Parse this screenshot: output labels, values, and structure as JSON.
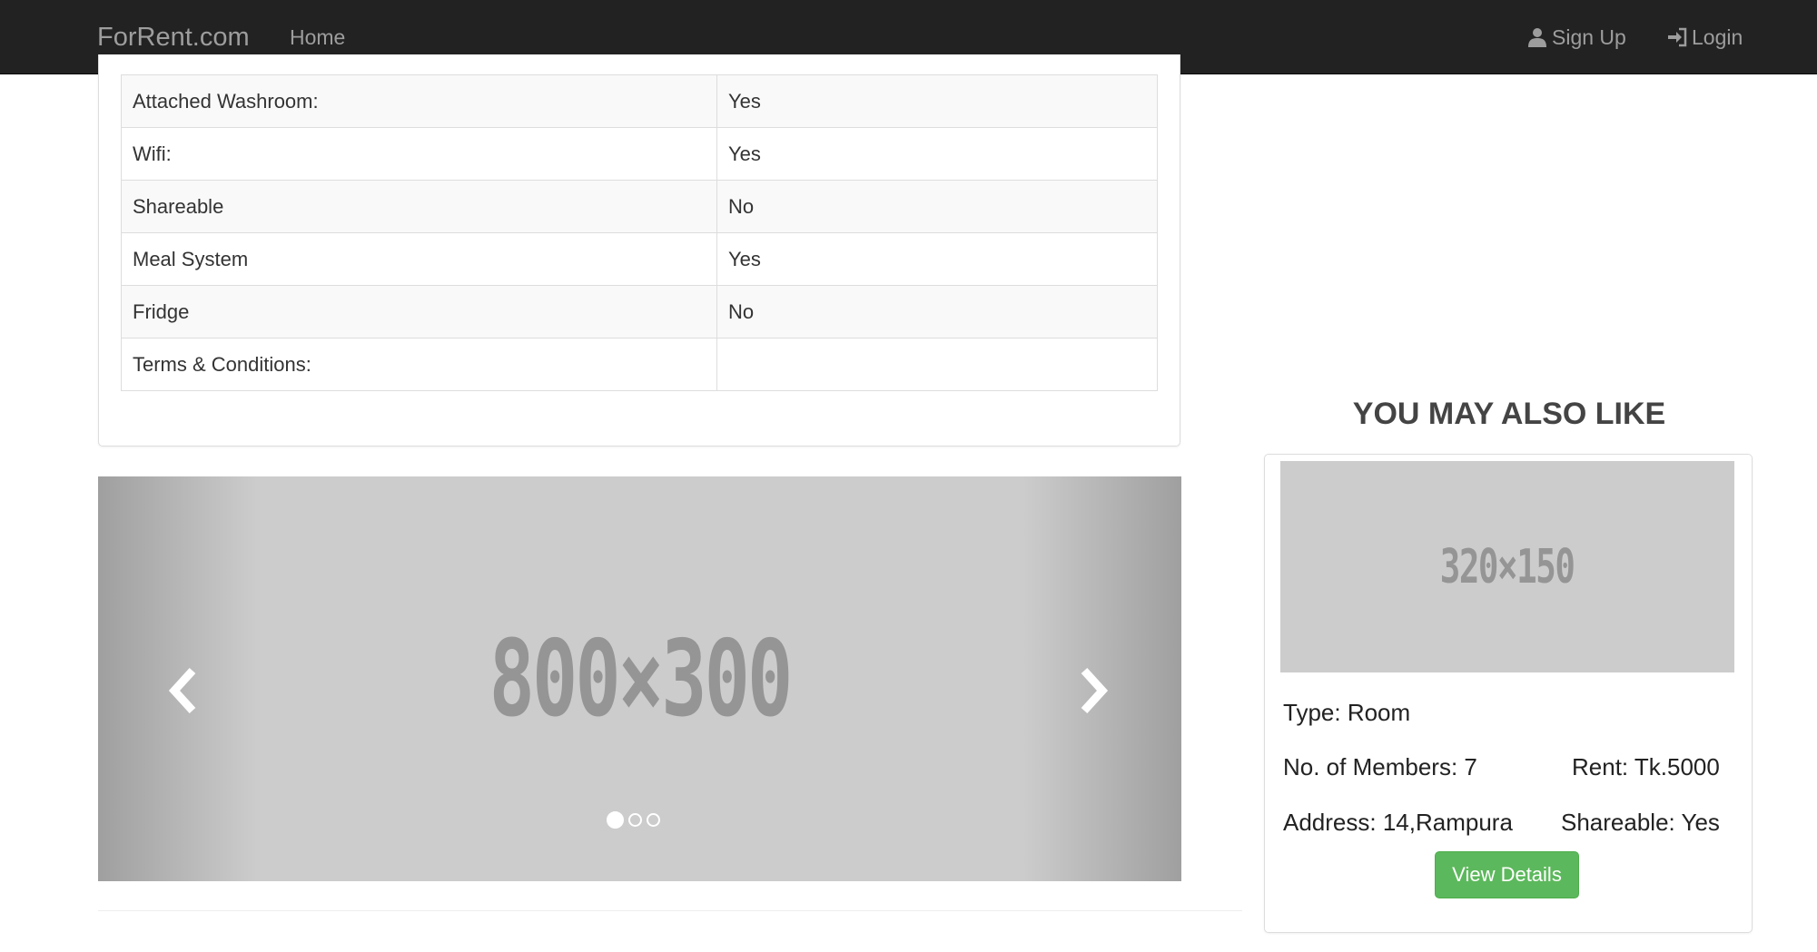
{
  "navbar": {
    "brand": "ForRent.com",
    "home": "Home",
    "signup": "Sign Up",
    "login": "Login"
  },
  "details": {
    "rows": [
      {
        "label": "Attached Washroom:",
        "value": "Yes"
      },
      {
        "label": "Wifi:",
        "value": "Yes"
      },
      {
        "label": "Shareable",
        "value": "No"
      },
      {
        "label": "Meal System",
        "value": "Yes"
      },
      {
        "label": "Fridge",
        "value": "No"
      },
      {
        "label": "Terms & Conditions:",
        "value": ""
      }
    ]
  },
  "carousel": {
    "image_text": "800×300",
    "slide_count": 3,
    "active_index": 0
  },
  "sidebar": {
    "title": "YOU MAY ALSO LIKE",
    "card": {
      "image_text": "320×150",
      "type": "Type: Room",
      "members": "No. of Members: 7",
      "rent": "Rent: Tk.5000",
      "address": "Address: 14,Rampura",
      "shareable": "Shareable: Yes",
      "button": "View Details"
    }
  },
  "colors": {
    "navbar_bg": "#222222",
    "nav_text": "#9d9d9d",
    "button_green": "#5cb85c",
    "placeholder_gray": "#cccccc"
  }
}
